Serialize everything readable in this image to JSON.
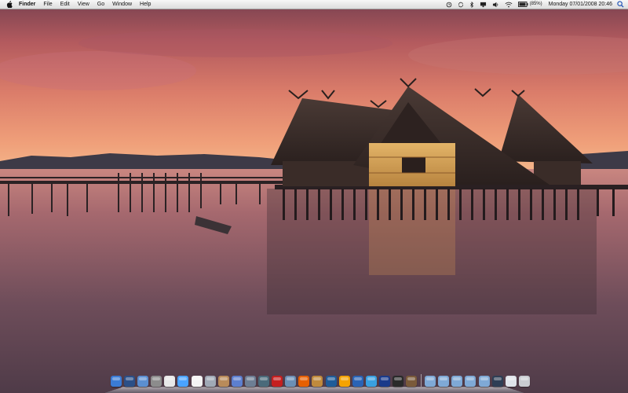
{
  "menubar": {
    "app_name": "Finder",
    "menus": [
      "File",
      "Edit",
      "View",
      "Go",
      "Window",
      "Help"
    ],
    "battery_percent": "(85%)",
    "clock": "Monday 07/01/2008 20:46"
  },
  "status_icons": [
    "time-machine-icon",
    "sync-icon",
    "bluetooth-icon",
    "display-icon",
    "volume-icon",
    "wifi-icon",
    "battery-icon"
  ],
  "dock": {
    "apps": [
      {
        "name": "finder-icon",
        "color": "#3a7bd5"
      },
      {
        "name": "dashboard-icon",
        "color": "#2b4f87"
      },
      {
        "name": "preview-icon",
        "color": "#5b8fd1"
      },
      {
        "name": "system-preferences-icon",
        "color": "#8c8c8c"
      },
      {
        "name": "textedit-icon",
        "color": "#e8e8e8"
      },
      {
        "name": "ichat-icon",
        "color": "#4aa3ff"
      },
      {
        "name": "ical-icon",
        "color": "#f4f4f4"
      },
      {
        "name": "photo-app-icon",
        "color": "#a0a9b6"
      },
      {
        "name": "iphoto-icon",
        "color": "#b98b5a"
      },
      {
        "name": "itunes-icon",
        "color": "#5d7fcf"
      },
      {
        "name": "spaces-icon",
        "color": "#6d7e94"
      },
      {
        "name": "time-machine-icon",
        "color": "#4a6a7a"
      },
      {
        "name": "pdf-icon",
        "color": "#c51f1f"
      },
      {
        "name": "safari-icon",
        "color": "#6b8fb5"
      },
      {
        "name": "firefox-icon",
        "color": "#e66000"
      },
      {
        "name": "utility-icon",
        "color": "#c08a3c"
      },
      {
        "name": "photo-booth-icon",
        "color": "#1f5c99"
      },
      {
        "name": "sync-app-icon",
        "color": "#f5a300"
      },
      {
        "name": "network-icon",
        "color": "#2a63b5"
      },
      {
        "name": "screen-icon",
        "color": "#39a0e0"
      },
      {
        "name": "xcode-icon",
        "color": "#1a3a8a"
      },
      {
        "name": "terminal-icon",
        "color": "#2a2a2a"
      },
      {
        "name": "guitar-icon",
        "color": "#7a5a3a"
      }
    ],
    "stacks": [
      {
        "name": "applications-folder-icon",
        "color": "#7fa9d6"
      },
      {
        "name": "documents-folder-icon",
        "color": "#7fa9d6"
      },
      {
        "name": "downloads-folder-icon",
        "color": "#7fa9d6"
      },
      {
        "name": "pictures-folder-icon",
        "color": "#7fa9d6"
      },
      {
        "name": "music-folder-icon",
        "color": "#7fa9d6"
      },
      {
        "name": "monitor-icon",
        "color": "#2e3e55"
      },
      {
        "name": "screenshot-icon",
        "color": "#dfe3ea"
      },
      {
        "name": "trash-icon",
        "color": "#c9ccd1"
      }
    ]
  }
}
